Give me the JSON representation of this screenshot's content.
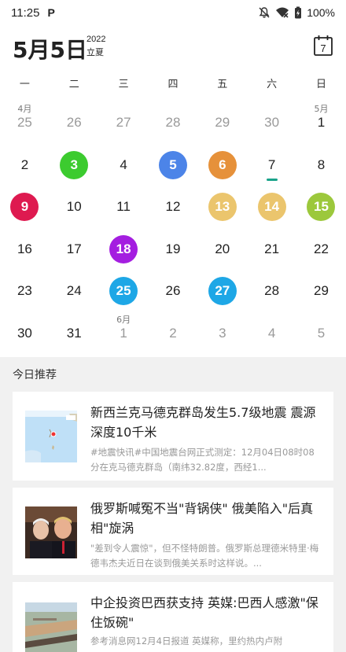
{
  "status_bar": {
    "time": "11:25",
    "app_icon": "P",
    "battery": "100%",
    "icons": [
      "notification-off-icon",
      "wifi-off-icon",
      "battery-icon"
    ]
  },
  "header": {
    "date": "5月5日",
    "year": "2022",
    "solar_term": "立夏",
    "today_button_day": "7"
  },
  "calendar": {
    "weekdays": [
      "一",
      "二",
      "三",
      "四",
      "五",
      "六",
      "日"
    ],
    "today_indicator_color": "#1aa38a",
    "rows": [
      [
        {
          "day": "25",
          "grey": true,
          "month_label": "4月"
        },
        {
          "day": "26",
          "grey": true
        },
        {
          "day": "27",
          "grey": true
        },
        {
          "day": "28",
          "grey": true
        },
        {
          "day": "29",
          "grey": true
        },
        {
          "day": "30",
          "grey": true
        },
        {
          "day": "1",
          "month_label": "5月"
        }
      ],
      [
        {
          "day": "2"
        },
        {
          "day": "3",
          "color": "#3ccb2f"
        },
        {
          "day": "4"
        },
        {
          "day": "5",
          "color": "#4c84e8"
        },
        {
          "day": "6",
          "color": "#e6913a"
        },
        {
          "day": "7",
          "today": true
        },
        {
          "day": "8"
        }
      ],
      [
        {
          "day": "9",
          "color": "#de1a50"
        },
        {
          "day": "10"
        },
        {
          "day": "11"
        },
        {
          "day": "12"
        },
        {
          "day": "13",
          "color": "#ebc56d"
        },
        {
          "day": "14",
          "color": "#ebc56d"
        },
        {
          "day": "15",
          "color": "#9cc83c"
        }
      ],
      [
        {
          "day": "16"
        },
        {
          "day": "17"
        },
        {
          "day": "18",
          "color": "#a41ee0"
        },
        {
          "day": "19"
        },
        {
          "day": "20"
        },
        {
          "day": "21"
        },
        {
          "day": "22"
        }
      ],
      [
        {
          "day": "23"
        },
        {
          "day": "24"
        },
        {
          "day": "25",
          "color": "#1ea7e6"
        },
        {
          "day": "26"
        },
        {
          "day": "27",
          "color": "#1ea7e6"
        },
        {
          "day": "28"
        },
        {
          "day": "29"
        }
      ],
      [
        {
          "day": "30"
        },
        {
          "day": "31"
        },
        {
          "day": "1",
          "grey": true,
          "month_label": "6月"
        },
        {
          "day": "2",
          "grey": true
        },
        {
          "day": "3",
          "grey": true
        },
        {
          "day": "4",
          "grey": true
        },
        {
          "day": "5",
          "grey": true
        }
      ]
    ]
  },
  "news": {
    "section_title": "今日推荐",
    "items": [
      {
        "headline": "新西兰克马德克群岛发生5.7级地震 震源深度10千米",
        "summary": "#地震快讯#中国地震台网正式测定：12月04日08时08分在克马德克群岛（南纬32.82度，西经1...",
        "thumb": "map"
      },
      {
        "headline": "俄罗斯喊冤不当\"背锅侠\" 俄美陷入\"后真相\"旋涡",
        "summary": "\"差到令人震惊\"，但不怪特朗普。俄罗斯总理德米特里·梅德韦杰夫近日在谈到俄美关系时这样说。...",
        "thumb": "people"
      },
      {
        "headline": "中企投资巴西获支持 英媒:巴西人感激\"保住饭碗\"",
        "summary": "参考消息网12月4日报道 英媒称，里约热内卢附",
        "thumb": "port"
      }
    ]
  }
}
